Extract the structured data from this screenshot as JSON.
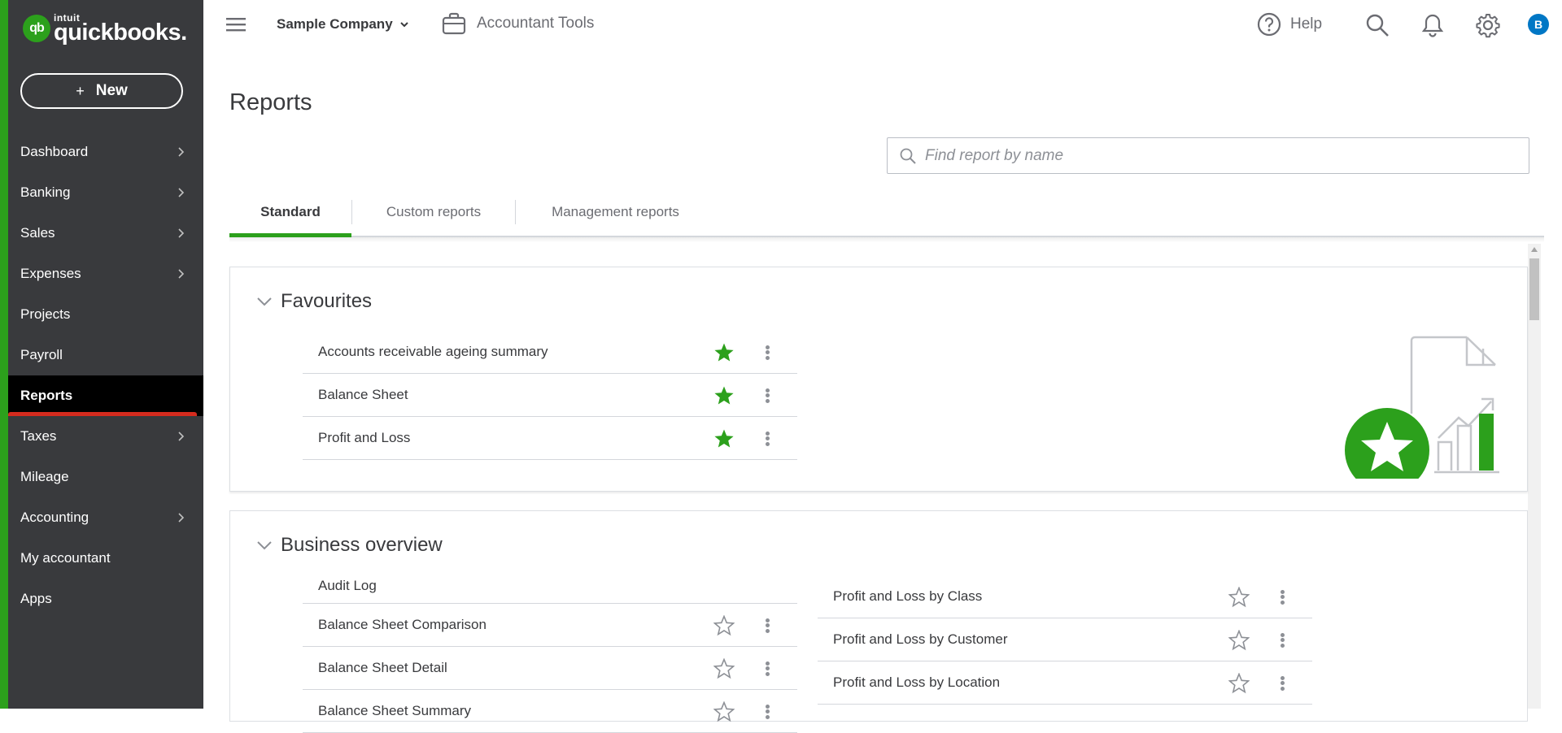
{
  "brand": {
    "mark": "qb",
    "top_word": "intuit",
    "product": "quickbooks.",
    "accent_color": "#2ca01c",
    "sidebar_color": "#393a3d"
  },
  "sidebar": {
    "new_button": {
      "icon": "plus-icon",
      "label": "New"
    },
    "items": [
      {
        "label": "Dashboard",
        "has_submenu": true
      },
      {
        "label": "Banking",
        "has_submenu": true
      },
      {
        "label": "Sales",
        "has_submenu": true
      },
      {
        "label": "Expenses",
        "has_submenu": true
      },
      {
        "label": "Projects",
        "has_submenu": false
      },
      {
        "label": "Payroll",
        "has_submenu": false
      },
      {
        "label": "Reports",
        "has_submenu": false,
        "active": true
      },
      {
        "label": "Taxes",
        "has_submenu": true
      },
      {
        "label": "Mileage",
        "has_submenu": false
      },
      {
        "label": "Accounting",
        "has_submenu": true
      },
      {
        "label": "My accountant",
        "has_submenu": false
      },
      {
        "label": "Apps",
        "has_submenu": false
      }
    ]
  },
  "topbar": {
    "menu_icon": "hamburger-icon",
    "company": "Sample Company",
    "accountant_tools": "Accountant Tools",
    "help": "Help",
    "icons": [
      "search-icon",
      "bell-icon",
      "gear-icon"
    ],
    "avatar_initial": "B",
    "avatar_color": "#0077c5"
  },
  "page": {
    "title": "Reports",
    "search_placeholder": "Find report by name",
    "tabs": [
      {
        "label": "Standard",
        "active": true
      },
      {
        "label": "Custom reports",
        "active": false
      },
      {
        "label": "Management reports",
        "active": false
      }
    ]
  },
  "favourites": {
    "title": "Favourites",
    "reports": [
      {
        "name": "Accounts receivable ageing summary",
        "favourite": true
      },
      {
        "name": "Balance Sheet",
        "favourite": true
      },
      {
        "name": "Profit and Loss",
        "favourite": true
      }
    ]
  },
  "business_overview": {
    "title": "Business overview",
    "left_column": [
      {
        "name": "Audit Log",
        "favourite": null
      },
      {
        "name": "Balance Sheet Comparison",
        "favourite": false
      },
      {
        "name": "Balance Sheet Detail",
        "favourite": false
      },
      {
        "name": "Balance Sheet Summary",
        "favourite": false
      }
    ],
    "right_column": [
      {
        "name": "Profit and Loss by Class",
        "favourite": false
      },
      {
        "name": "Profit and Loss by Customer",
        "favourite": false
      },
      {
        "name": "Profit and Loss by Location",
        "favourite": false
      }
    ]
  }
}
